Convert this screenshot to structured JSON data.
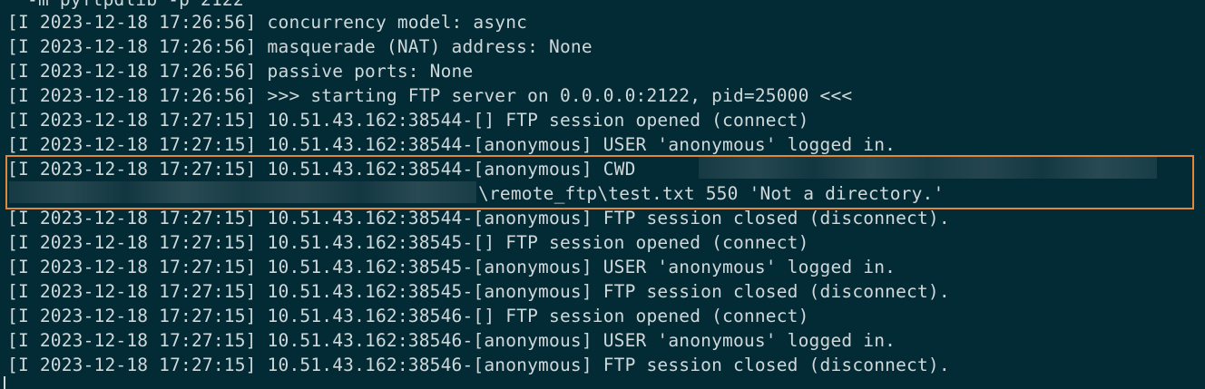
{
  "terminal": {
    "top_partial": "-m pyftpdlib -p 2122",
    "lines": [
      "[I 2023-12-18 17:26:56] concurrency model: async",
      "[I 2023-12-18 17:26:56] masquerade (NAT) address: None",
      "[I 2023-12-18 17:26:56] passive ports: None",
      "[I 2023-12-18 17:26:56] >>> starting FTP server on 0.0.0.0:2122, pid=25000 <<<",
      "[I 2023-12-18 17:27:15] 10.51.43.162:38544-[] FTP session opened (connect)",
      "[I 2023-12-18 17:27:15] 10.51.43.162:38544-[anonymous] USER 'anonymous' logged in.",
      "[I 2023-12-18 17:27:15] 10.51.43.162:38544-[anonymous] CWD",
      "\\remote_ftp\\test.txt 550 'Not a directory.'",
      "[I 2023-12-18 17:27:15] 10.51.43.162:38544-[anonymous] FTP session closed (disconnect).",
      "[I 2023-12-18 17:27:15] 10.51.43.162:38545-[] FTP session opened (connect)",
      "[I 2023-12-18 17:27:15] 10.51.43.162:38545-[anonymous] USER 'anonymous' logged in.",
      "[I 2023-12-18 17:27:15] 10.51.43.162:38545-[anonymous] FTP session closed (disconnect).",
      "[I 2023-12-18 17:27:15] 10.51.43.162:38546-[] FTP session opened (connect)",
      "[I 2023-12-18 17:27:15] 10.51.43.162:38546-[anonymous] USER 'anonymous' logged in.",
      "[I 2023-12-18 17:27:15] 10.51.43.162:38546-[anonymous] FTP session closed (disconnect)."
    ]
  },
  "colors": {
    "background": "#022b36",
    "text": "#d0d8da",
    "highlight_border": "#e0883a"
  }
}
